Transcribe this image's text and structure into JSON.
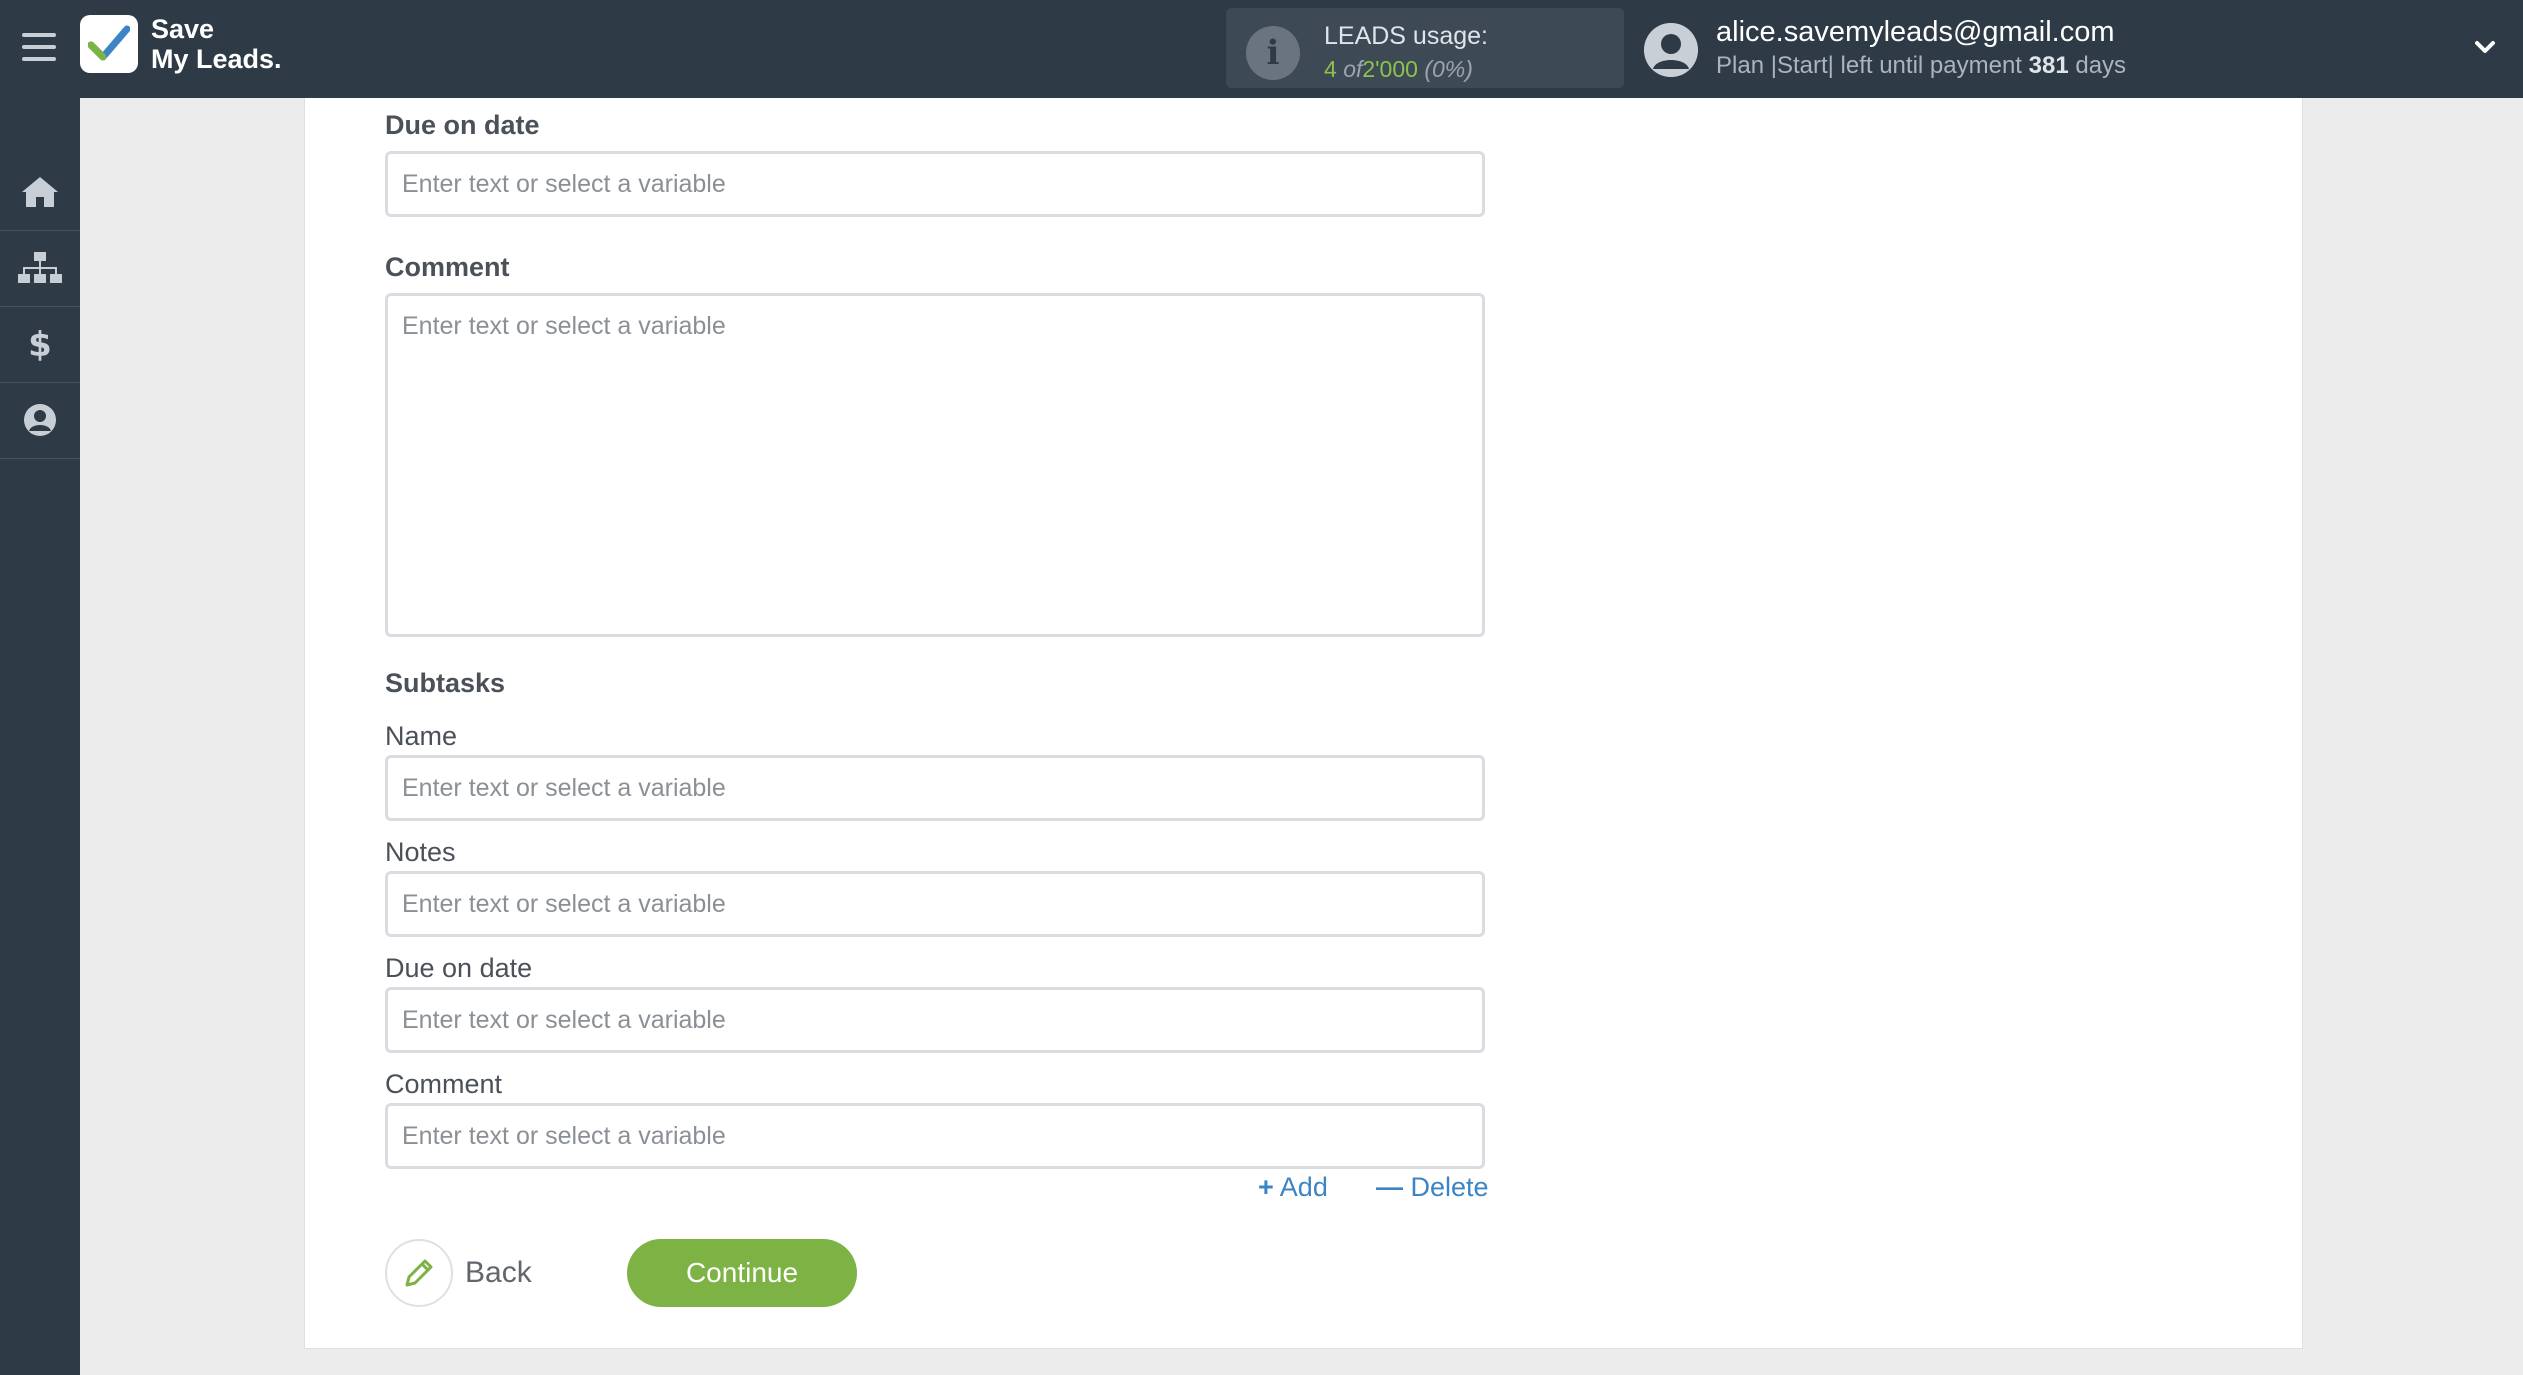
{
  "app": {
    "logo_line1": "Save",
    "logo_line2": "My Leads."
  },
  "usage": {
    "title": "LEADS usage:",
    "count": "4",
    "of_word": "of",
    "total": "2'000",
    "percent": "(0%)"
  },
  "user": {
    "email": "alice.savemyleads@gmail.com",
    "plan_prefix": "Plan |Start| left until payment",
    "days_number": "381",
    "days_suffix": "days"
  },
  "sidebar": {
    "items": [
      {
        "icon": "home-icon"
      },
      {
        "icon": "sitemap-icon"
      },
      {
        "icon": "dollar-icon"
      },
      {
        "icon": "user-icon"
      }
    ]
  },
  "form": {
    "due_on_date_label": "Due on date",
    "comment_label": "Comment",
    "subtasks_label": "Subtasks",
    "sub_name_label": "Name",
    "sub_notes_label": "Notes",
    "sub_due_label": "Due on date",
    "sub_comment_label": "Comment",
    "placeholder": "Enter text or select a variable",
    "add_label": "Add",
    "delete_label": "Delete",
    "back_label": "Back",
    "continue_label": "Continue"
  },
  "colors": {
    "topbar": "#2e3a46",
    "accent_green": "#7db244",
    "link_blue": "#3c84c5"
  }
}
